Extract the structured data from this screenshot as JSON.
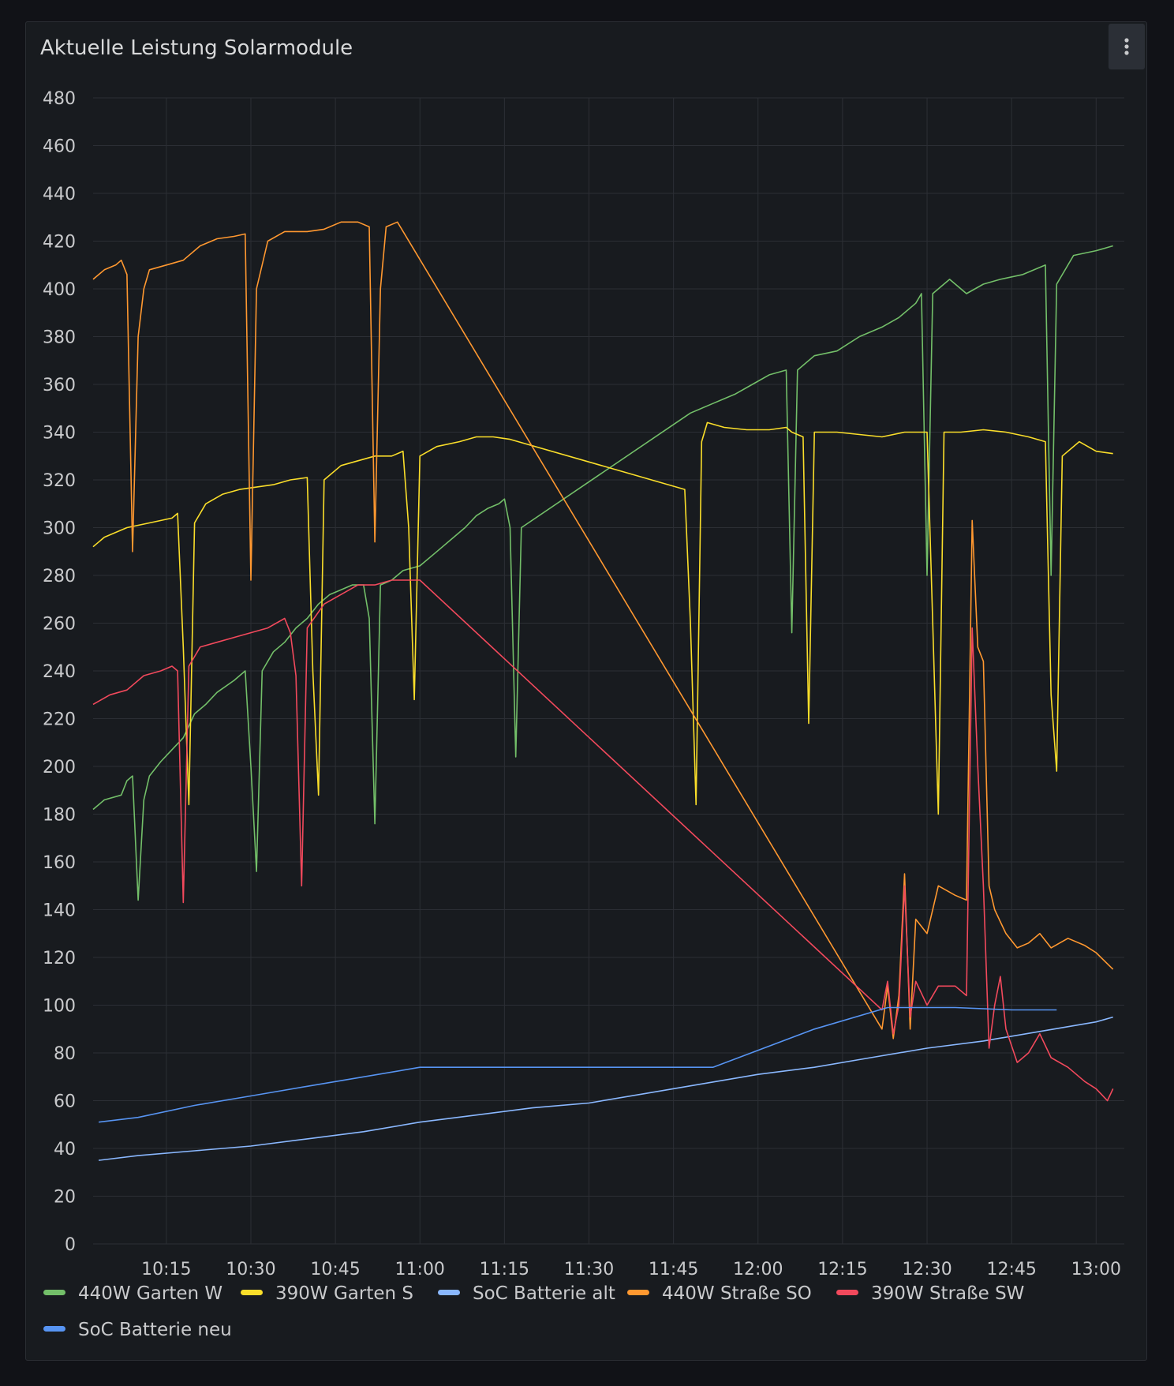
{
  "panel": {
    "title": "Aktuelle Leistung Solarmodule",
    "menu_icon": "kebab-menu-icon"
  },
  "chart_data": {
    "type": "line",
    "ylim": [
      0,
      480
    ],
    "yticks": [
      0,
      20,
      40,
      60,
      80,
      100,
      120,
      140,
      160,
      180,
      200,
      220,
      240,
      260,
      280,
      300,
      320,
      340,
      360,
      380,
      400,
      420,
      440,
      460,
      480
    ],
    "xlim": [
      "10:02",
      "13:05"
    ],
    "xticks": [
      "10:15",
      "10:30",
      "10:45",
      "11:00",
      "11:15",
      "11:30",
      "11:45",
      "12:00",
      "12:15",
      "12:30",
      "12:45",
      "13:00"
    ],
    "grid": true,
    "legend_placement": "bottom",
    "series": [
      {
        "name": "440W Garten W",
        "color": "#73bf69",
        "points": [
          [
            "10:02",
            182
          ],
          [
            "10:04",
            186
          ],
          [
            "10:07",
            188
          ],
          [
            "10:08",
            194
          ],
          [
            "10:09",
            196
          ],
          [
            "10:10",
            144
          ],
          [
            "10:11",
            186
          ],
          [
            "10:12",
            196
          ],
          [
            "10:14",
            202
          ],
          [
            "10:16",
            207
          ],
          [
            "10:18",
            212
          ],
          [
            "10:20",
            222
          ],
          [
            "10:22",
            226
          ],
          [
            "10:24",
            231
          ],
          [
            "10:27",
            236
          ],
          [
            "10:29",
            240
          ],
          [
            "10:30",
            200
          ],
          [
            "10:31",
            156
          ],
          [
            "10:32",
            240
          ],
          [
            "10:34",
            248
          ],
          [
            "10:36",
            252
          ],
          [
            "10:38",
            258
          ],
          [
            "10:40",
            262
          ],
          [
            "10:42",
            268
          ],
          [
            "10:44",
            272
          ],
          [
            "10:46",
            274
          ],
          [
            "10:48",
            276
          ],
          [
            "10:50",
            276
          ],
          [
            "10:51",
            262
          ],
          [
            "10:52",
            176
          ],
          [
            "10:53",
            276
          ],
          [
            "10:55",
            278
          ],
          [
            "10:57",
            282
          ],
          [
            "11:00",
            284
          ],
          [
            "11:03",
            290
          ],
          [
            "11:06",
            296
          ],
          [
            "11:08",
            300
          ],
          [
            "11:10",
            305
          ],
          [
            "11:12",
            308
          ],
          [
            "11:14",
            310
          ],
          [
            "11:15",
            312
          ],
          [
            "11:16",
            300
          ],
          [
            "11:17",
            204
          ],
          [
            "11:18",
            300
          ],
          [
            "11:48",
            348
          ],
          [
            "11:52",
            352
          ],
          [
            "11:56",
            356
          ],
          [
            "11:59",
            360
          ],
          [
            "12:02",
            364
          ],
          [
            "12:05",
            366
          ],
          [
            "12:06",
            256
          ],
          [
            "12:07",
            366
          ],
          [
            "12:10",
            372
          ],
          [
            "12:14",
            374
          ],
          [
            "12:18",
            380
          ],
          [
            "12:22",
            384
          ],
          [
            "12:25",
            388
          ],
          [
            "12:28",
            394
          ],
          [
            "12:29",
            398
          ],
          [
            "12:30",
            280
          ],
          [
            "12:31",
            398
          ],
          [
            "12:34",
            404
          ],
          [
            "12:37",
            398
          ],
          [
            "12:40",
            402
          ],
          [
            "12:43",
            404
          ],
          [
            "12:47",
            406
          ],
          [
            "12:51",
            410
          ],
          [
            "12:52",
            280
          ],
          [
            "12:53",
            402
          ],
          [
            "12:56",
            414
          ],
          [
            "13:00",
            416
          ],
          [
            "13:03",
            418
          ]
        ]
      },
      {
        "name": "390W Garten S",
        "color": "#fade2a",
        "points": [
          [
            "10:02",
            292
          ],
          [
            "10:04",
            296
          ],
          [
            "10:08",
            300
          ],
          [
            "10:12",
            302
          ],
          [
            "10:16",
            304
          ],
          [
            "10:17",
            306
          ],
          [
            "10:18",
            250
          ],
          [
            "10:19",
            184
          ],
          [
            "10:20",
            302
          ],
          [
            "10:22",
            310
          ],
          [
            "10:25",
            314
          ],
          [
            "10:28",
            316
          ],
          [
            "10:31",
            317
          ],
          [
            "10:34",
            318
          ],
          [
            "10:37",
            320
          ],
          [
            "10:40",
            321
          ],
          [
            "10:41",
            240
          ],
          [
            "10:42",
            188
          ],
          [
            "10:43",
            320
          ],
          [
            "10:46",
            326
          ],
          [
            "10:49",
            328
          ],
          [
            "10:52",
            330
          ],
          [
            "10:55",
            330
          ],
          [
            "10:57",
            332
          ],
          [
            "10:58",
            300
          ],
          [
            "10:59",
            228
          ],
          [
            "11:00",
            330
          ],
          [
            "11:03",
            334
          ],
          [
            "11:07",
            336
          ],
          [
            "11:10",
            338
          ],
          [
            "11:13",
            338
          ],
          [
            "11:16",
            337
          ],
          [
            "11:47",
            316
          ],
          [
            "11:48",
            260
          ],
          [
            "11:49",
            184
          ],
          [
            "11:50",
            336
          ],
          [
            "11:51",
            344
          ],
          [
            "11:54",
            342
          ],
          [
            "11:58",
            341
          ],
          [
            "12:02",
            341
          ],
          [
            "12:05",
            342
          ],
          [
            "12:06",
            340
          ],
          [
            "12:08",
            338
          ],
          [
            "12:09",
            218
          ],
          [
            "12:10",
            340
          ],
          [
            "12:14",
            340
          ],
          [
            "12:18",
            339
          ],
          [
            "12:22",
            338
          ],
          [
            "12:26",
            340
          ],
          [
            "12:29",
            340
          ],
          [
            "12:30",
            340
          ],
          [
            "12:31",
            260
          ],
          [
            "12:32",
            180
          ],
          [
            "12:33",
            340
          ],
          [
            "12:36",
            340
          ],
          [
            "12:40",
            341
          ],
          [
            "12:44",
            340
          ],
          [
            "12:48",
            338
          ],
          [
            "12:51",
            336
          ],
          [
            "12:52",
            230
          ],
          [
            "12:53",
            198
          ],
          [
            "12:54",
            330
          ],
          [
            "12:57",
            336
          ],
          [
            "13:00",
            332
          ],
          [
            "13:03",
            331
          ]
        ]
      },
      {
        "name": "SoC Batterie alt",
        "color": "#8ab8ff",
        "points": [
          [
            "10:03",
            35
          ],
          [
            "10:10",
            37
          ],
          [
            "10:20",
            39
          ],
          [
            "10:30",
            41
          ],
          [
            "10:40",
            44
          ],
          [
            "10:50",
            47
          ],
          [
            "11:00",
            51
          ],
          [
            "11:10",
            54
          ],
          [
            "11:20",
            57
          ],
          [
            "11:30",
            59
          ],
          [
            "11:40",
            63
          ],
          [
            "11:50",
            67
          ],
          [
            "12:00",
            71
          ],
          [
            "12:10",
            74
          ],
          [
            "12:20",
            78
          ],
          [
            "12:30",
            82
          ],
          [
            "12:40",
            85
          ],
          [
            "12:50",
            89
          ],
          [
            "13:00",
            93
          ],
          [
            "13:03",
            95
          ]
        ]
      },
      {
        "name": "440W Straße SO",
        "color": "#ff9830",
        "points": [
          [
            "10:02",
            404
          ],
          [
            "10:04",
            408
          ],
          [
            "10:06",
            410
          ],
          [
            "10:07",
            412
          ],
          [
            "10:08",
            406
          ],
          [
            "10:09",
            290
          ],
          [
            "10:10",
            380
          ],
          [
            "10:11",
            400
          ],
          [
            "10:12",
            408
          ],
          [
            "10:15",
            410
          ],
          [
            "10:18",
            412
          ],
          [
            "10:21",
            418
          ],
          [
            "10:24",
            421
          ],
          [
            "10:27",
            422
          ],
          [
            "10:29",
            423
          ],
          [
            "10:30",
            278
          ],
          [
            "10:31",
            400
          ],
          [
            "10:33",
            420
          ],
          [
            "10:36",
            424
          ],
          [
            "10:40",
            424
          ],
          [
            "10:43",
            425
          ],
          [
            "10:46",
            428
          ],
          [
            "10:49",
            428
          ],
          [
            "10:51",
            426
          ],
          [
            "10:52",
            294
          ],
          [
            "10:53",
            400
          ],
          [
            "10:54",
            426
          ],
          [
            "10:56",
            428
          ],
          [
            "12:22",
            90
          ],
          [
            "12:23",
            108
          ],
          [
            "12:24",
            86
          ],
          [
            "12:25",
            104
          ],
          [
            "12:26",
            155
          ],
          [
            "12:27",
            90
          ],
          [
            "12:28",
            136
          ],
          [
            "12:30",
            130
          ],
          [
            "12:32",
            150
          ],
          [
            "12:35",
            146
          ],
          [
            "12:37",
            144
          ],
          [
            "12:38",
            303
          ],
          [
            "12:39",
            250
          ],
          [
            "12:40",
            244
          ],
          [
            "12:41",
            150
          ],
          [
            "12:42",
            140
          ],
          [
            "12:44",
            130
          ],
          [
            "12:46",
            124
          ],
          [
            "12:48",
            126
          ],
          [
            "12:50",
            130
          ],
          [
            "12:52",
            124
          ],
          [
            "12:55",
            128
          ],
          [
            "12:58",
            125
          ],
          [
            "13:00",
            122
          ],
          [
            "13:03",
            115
          ]
        ]
      },
      {
        "name": "390W Straße SW",
        "color": "#f2495c",
        "points": [
          [
            "10:02",
            226
          ],
          [
            "10:05",
            230
          ],
          [
            "10:08",
            232
          ],
          [
            "10:11",
            238
          ],
          [
            "10:14",
            240
          ],
          [
            "10:16",
            242
          ],
          [
            "10:17",
            240
          ],
          [
            "10:18",
            143
          ],
          [
            "10:19",
            242
          ],
          [
            "10:21",
            250
          ],
          [
            "10:24",
            252
          ],
          [
            "10:27",
            254
          ],
          [
            "10:30",
            256
          ],
          [
            "10:33",
            258
          ],
          [
            "10:36",
            262
          ],
          [
            "10:37",
            256
          ],
          [
            "10:38",
            238
          ],
          [
            "10:39",
            150
          ],
          [
            "10:40",
            258
          ],
          [
            "10:43",
            268
          ],
          [
            "10:46",
            272
          ],
          [
            "10:49",
            276
          ],
          [
            "10:52",
            276
          ],
          [
            "10:55",
            278
          ],
          [
            "10:57",
            278
          ],
          [
            "11:00",
            278
          ],
          [
            "12:22",
            98
          ],
          [
            "12:23",
            110
          ],
          [
            "12:24",
            88
          ],
          [
            "12:25",
            100
          ],
          [
            "12:26",
            150
          ],
          [
            "12:27",
            95
          ],
          [
            "12:28",
            110
          ],
          [
            "12:30",
            100
          ],
          [
            "12:32",
            108
          ],
          [
            "12:35",
            108
          ],
          [
            "12:37",
            104
          ],
          [
            "12:38",
            258
          ],
          [
            "12:39",
            200
          ],
          [
            "12:40",
            150
          ],
          [
            "12:41",
            82
          ],
          [
            "12:42",
            100
          ],
          [
            "12:43",
            112
          ],
          [
            "12:44",
            90
          ],
          [
            "12:46",
            76
          ],
          [
            "12:48",
            80
          ],
          [
            "12:50",
            88
          ],
          [
            "12:52",
            78
          ],
          [
            "12:55",
            74
          ],
          [
            "12:58",
            68
          ],
          [
            "13:00",
            65
          ],
          [
            "13:02",
            60
          ],
          [
            "13:03",
            65
          ]
        ]
      },
      {
        "name": "SoC Batterie neu",
        "color": "#5794f2",
        "points": [
          [
            "10:03",
            51
          ],
          [
            "10:10",
            53
          ],
          [
            "10:20",
            58
          ],
          [
            "10:30",
            62
          ],
          [
            "10:40",
            66
          ],
          [
            "10:50",
            70
          ],
          [
            "11:00",
            74
          ],
          [
            "11:15",
            74
          ],
          [
            "11:30",
            74
          ],
          [
            "11:52",
            74
          ],
          [
            "12:10",
            90
          ],
          [
            "12:23",
            99
          ],
          [
            "12:35",
            99
          ],
          [
            "12:45",
            98
          ],
          [
            "12:53",
            98
          ]
        ]
      }
    ]
  }
}
